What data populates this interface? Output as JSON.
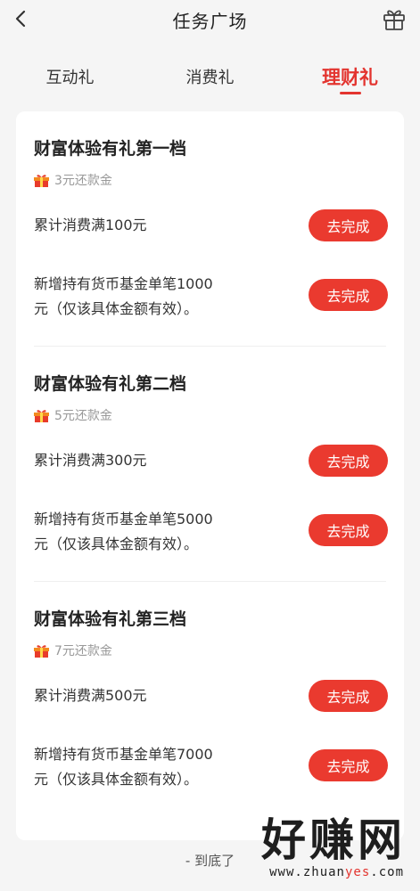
{
  "header": {
    "title": "任务广场"
  },
  "tabs": [
    {
      "label": "互动礼",
      "active": false
    },
    {
      "label": "消费礼",
      "active": false
    },
    {
      "label": "理财礼",
      "active": true
    }
  ],
  "tiers": [
    {
      "title": "财富体验有礼第一档",
      "reward": "3元还款金",
      "tasks": [
        {
          "line1": "累计消费满100元",
          "line2": "",
          "button": "去完成"
        },
        {
          "line1": "新增持有货币基金单笔1000",
          "line2": "元（仅该具体金额有效）。",
          "button": "去完成"
        }
      ]
    },
    {
      "title": "财富体验有礼第二档",
      "reward": "5元还款金",
      "tasks": [
        {
          "line1": "累计消费满300元",
          "line2": "",
          "button": "去完成"
        },
        {
          "line1": "新增持有货币基金单笔5000",
          "line2": "元（仅该具体金额有效）。",
          "button": "去完成"
        }
      ]
    },
    {
      "title": "财富体验有礼第三档",
      "reward": "7元还款金",
      "tasks": [
        {
          "line1": "累计消费满500元",
          "line2": "",
          "button": "去完成"
        },
        {
          "line1": "新增持有货币基金单笔7000",
          "line2": "元（仅该具体金额有效）。",
          "button": "去完成"
        }
      ]
    }
  ],
  "footer": {
    "end_text": "- 到底了"
  },
  "watermark": {
    "big": "好赚网",
    "small_prefix": "www.zhuan",
    "small_highlight": "yes",
    "small_suffix": ".com"
  },
  "colors": {
    "accent": "#e3342f",
    "button": "#ea3a2f",
    "background": "#f5f5f5"
  }
}
